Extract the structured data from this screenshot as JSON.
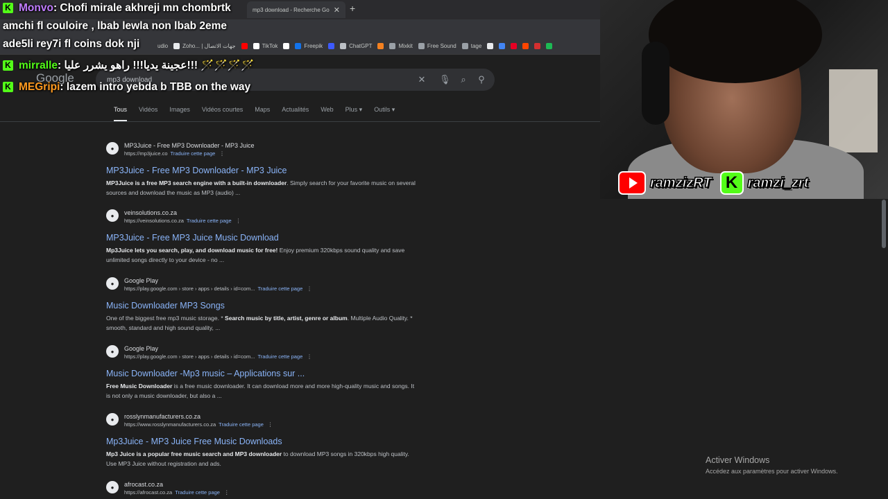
{
  "browser": {
    "active_tab_title": "mp3 download - Recherche Go",
    "bookmarks": [
      {
        "label": "udio",
        "color": "#35363a"
      },
      {
        "label": "Zoho... | جهات الاتصال",
        "color": "#e8eaed"
      },
      {
        "label": "",
        "color": "#ff0000"
      },
      {
        "label": "TikTok",
        "color": "#ffffff"
      },
      {
        "label": "",
        "color": "#ffffff"
      },
      {
        "label": "Freepik",
        "color": "#1273eb"
      },
      {
        "label": "",
        "color": "#3d5afe"
      },
      {
        "label": "ChatGPT",
        "color": "#bdc1c6"
      },
      {
        "label": "",
        "color": "#f48120"
      },
      {
        "label": "Mixkit",
        "color": "#9aa0a6"
      },
      {
        "label": "Free Sound",
        "color": "#9aa0a6"
      },
      {
        "label": "tage",
        "color": "#9aa0a6"
      },
      {
        "label": "",
        "color": "#e8eaed"
      },
      {
        "label": "",
        "color": "#4285f4"
      },
      {
        "label": "",
        "color": "#e60023"
      },
      {
        "label": "",
        "color": "#ff4500"
      },
      {
        "label": "",
        "color": "#d32f2f"
      },
      {
        "label": "",
        "color": "#1db954"
      }
    ]
  },
  "google": {
    "logo": "Google",
    "query": "mp3 download",
    "tabs": [
      "Tous",
      "Vidéos",
      "Images",
      "Vidéos courtes",
      "Maps",
      "Actualités",
      "Web",
      "Plus ▾",
      "Outils ▾"
    ],
    "translate_label": "Traduire cette page",
    "results": [
      {
        "site": "MP3Juice - Free MP3 Downloader - MP3 Juice",
        "url": "https://mp3juice.co",
        "title": "MP3Juice - Free MP3 Downloader - MP3 Juice",
        "snippet_bold": "MP3Juice is a free MP3 search engine with a built-in downloader",
        "snippet_rest": ". Simply search for your favorite music on several sources and download the music as MP3 (audio) ..."
      },
      {
        "site": "veinsolutions.co.za",
        "url": "https://veinsolutions.co.za",
        "title": "MP3Juice - Free MP3 Juice Music Download",
        "snippet_bold": "Mp3Juice lets you search, play, and download music for free!",
        "snippet_rest": " Enjoy premium 320kbps sound quality and save unlimited songs directly to your device - no ..."
      },
      {
        "site": "Google Play",
        "url": "https://play.google.com › store › apps › details › id=com...",
        "title": "Music Downloader MP3 Songs",
        "snippet_pre": "One of the biggest free mp3 music storage. * ",
        "snippet_bold": "Search music by title, artist, genre or album",
        "snippet_rest": ". Multiple Audio Quality. * smooth, standard and high sound quality, ..."
      },
      {
        "site": "Google Play",
        "url": "https://play.google.com › store › apps › details › id=com...",
        "title": "Music Downloader -Mp3 music – Applications sur ...",
        "snippet_bold": "Free Music Downloader",
        "snippet_rest": " is a free music downloader. It can download more and more high-quality music and songs. It is not only a music downloader, but also a ..."
      },
      {
        "site": "rosslynmanufacturers.co.za",
        "url": "https://www.rosslynmanufacturers.co.za",
        "title": "Mp3Juice - MP3 Juice Free Music Downloads",
        "snippet_bold": "Mp3 Juice is a popular free music search and MP3 downloader",
        "snippet_rest": " to download MP3 songs in 320kbps high quality. Use MP3 Juice without registration and ads."
      },
      {
        "site": "afrocast.co.za",
        "url": "https://afrocast.co.za",
        "title": "",
        "snippet_bold": "",
        "snippet_rest": ""
      }
    ]
  },
  "chat": [
    {
      "user": "Monvo",
      "color": "#c07cff",
      "message": ": Chofi mirale akhreji mn chombrtk"
    },
    {
      "user": "",
      "color": "#ffffff",
      "message": "amchi fl couloire , lbab lewla non lbab 2eme"
    },
    {
      "user": "",
      "color": "#ffffff",
      "message": "ade5li rey7i fl coins dok nji"
    },
    {
      "user": "mirralle",
      "color": "#53fc18",
      "message": ": عجينة يديا!!! راهو يشرر عليا!!! 🪄🪄🪄🪄"
    },
    {
      "user": "MEGripi",
      "color": "#ff9a1f",
      "message": ": lazem intro yebda b TBB on the way"
    }
  ],
  "stream": {
    "kick_badge": "K",
    "youtube_handle": "ramzizRT",
    "kick_handle": "ramzi_zrt"
  },
  "windows": {
    "activate_title": "Activer Windows",
    "activate_sub": "Accédez aux paramètres pour activer Windows."
  }
}
